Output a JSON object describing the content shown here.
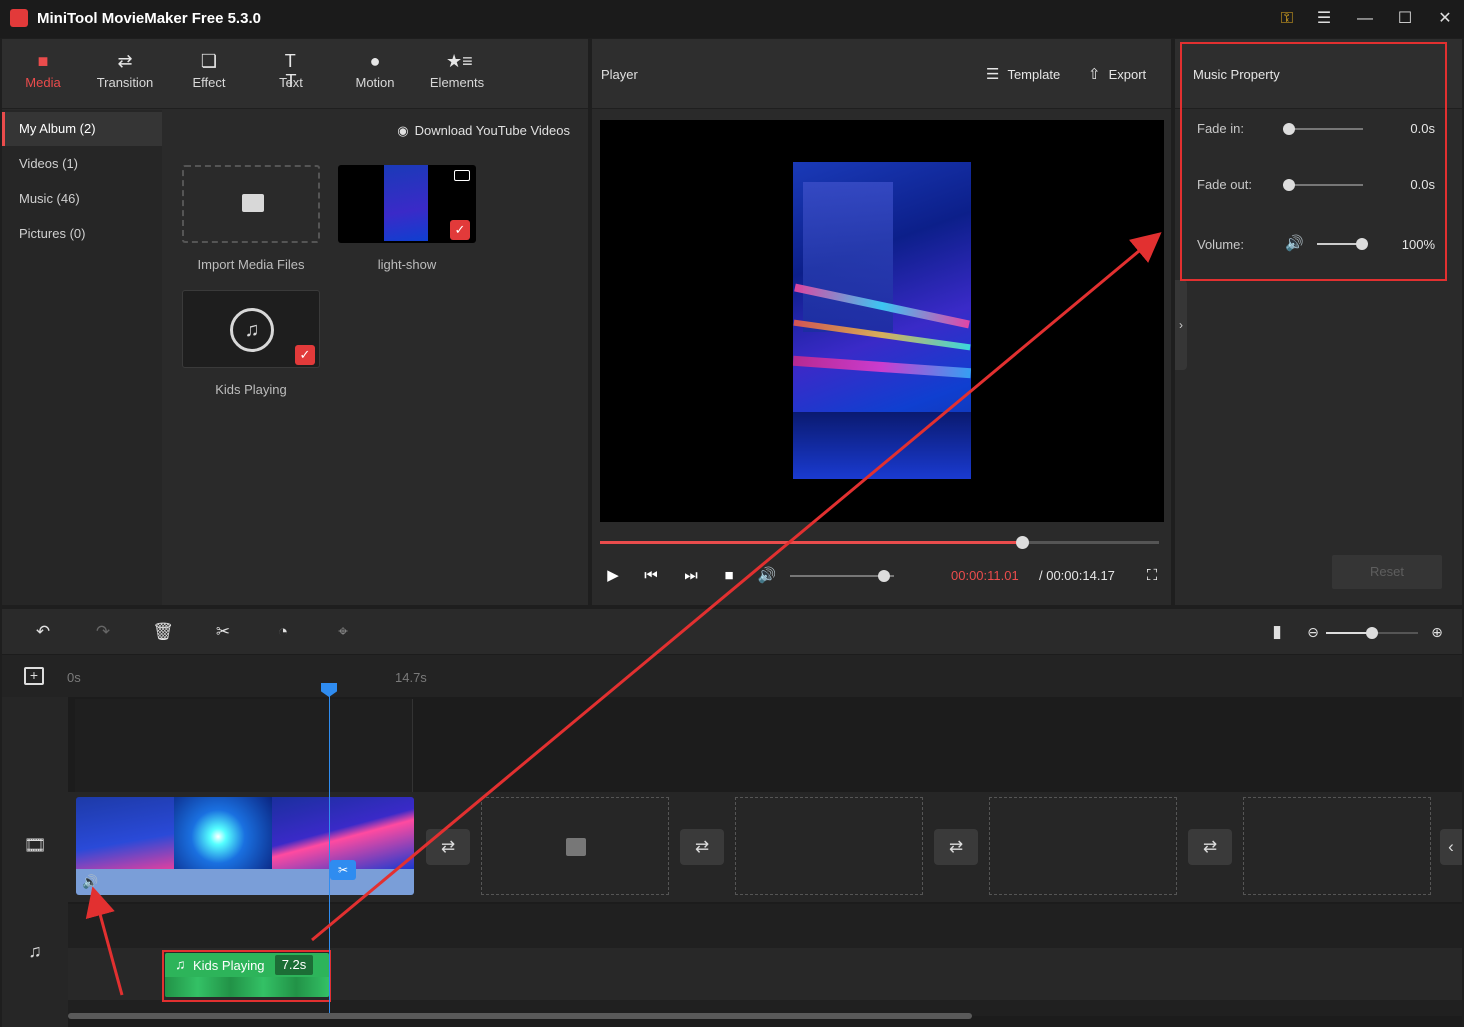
{
  "app": {
    "title": "MiniTool MovieMaker Free 5.3.0"
  },
  "top_tabs": [
    {
      "label": "Media",
      "icon": "folder-icon",
      "active": true
    },
    {
      "label": "Transition",
      "icon": "transition-icon"
    },
    {
      "label": "Effect",
      "icon": "effect-icon"
    },
    {
      "label": "Text",
      "icon": "text-icon"
    },
    {
      "label": "Motion",
      "icon": "motion-icon"
    },
    {
      "label": "Elements",
      "icon": "elements-icon"
    }
  ],
  "album_nav": [
    {
      "label": "My Album (2)",
      "active": true
    },
    {
      "label": "Videos (1)"
    },
    {
      "label": "Music (46)"
    },
    {
      "label": "Pictures (0)"
    }
  ],
  "media": {
    "download_label": "Download YouTube Videos",
    "items": [
      {
        "label": "Import Media Files"
      },
      {
        "label": "light-show"
      },
      {
        "label": "Kids Playing"
      }
    ]
  },
  "player": {
    "title": "Player",
    "template_label": "Template",
    "export_label": "Export",
    "progress": 0.755,
    "current_time": "00:00:11.01",
    "total_time": "/ 00:00:14.17",
    "volume": 0.9
  },
  "music_property": {
    "title": "Music Property",
    "fade_in_label": "Fade in:",
    "fade_in_value": "0.0s",
    "fade_out_label": "Fade out:",
    "fade_out_value": "0.0s",
    "volume_label": "Volume:",
    "volume_value": "100%",
    "reset_label": "Reset"
  },
  "timeline": {
    "ruler_start": "0s",
    "ruler_end": "14.7s",
    "music_clip_label": "Kids Playing",
    "music_clip_duration": "7.2s",
    "zoom": 0.5
  },
  "colors": {
    "accent": "#ea4c4c",
    "playhead": "#2f8cf0",
    "music_clip": "#2db45a",
    "annotation": "#e23030"
  }
}
